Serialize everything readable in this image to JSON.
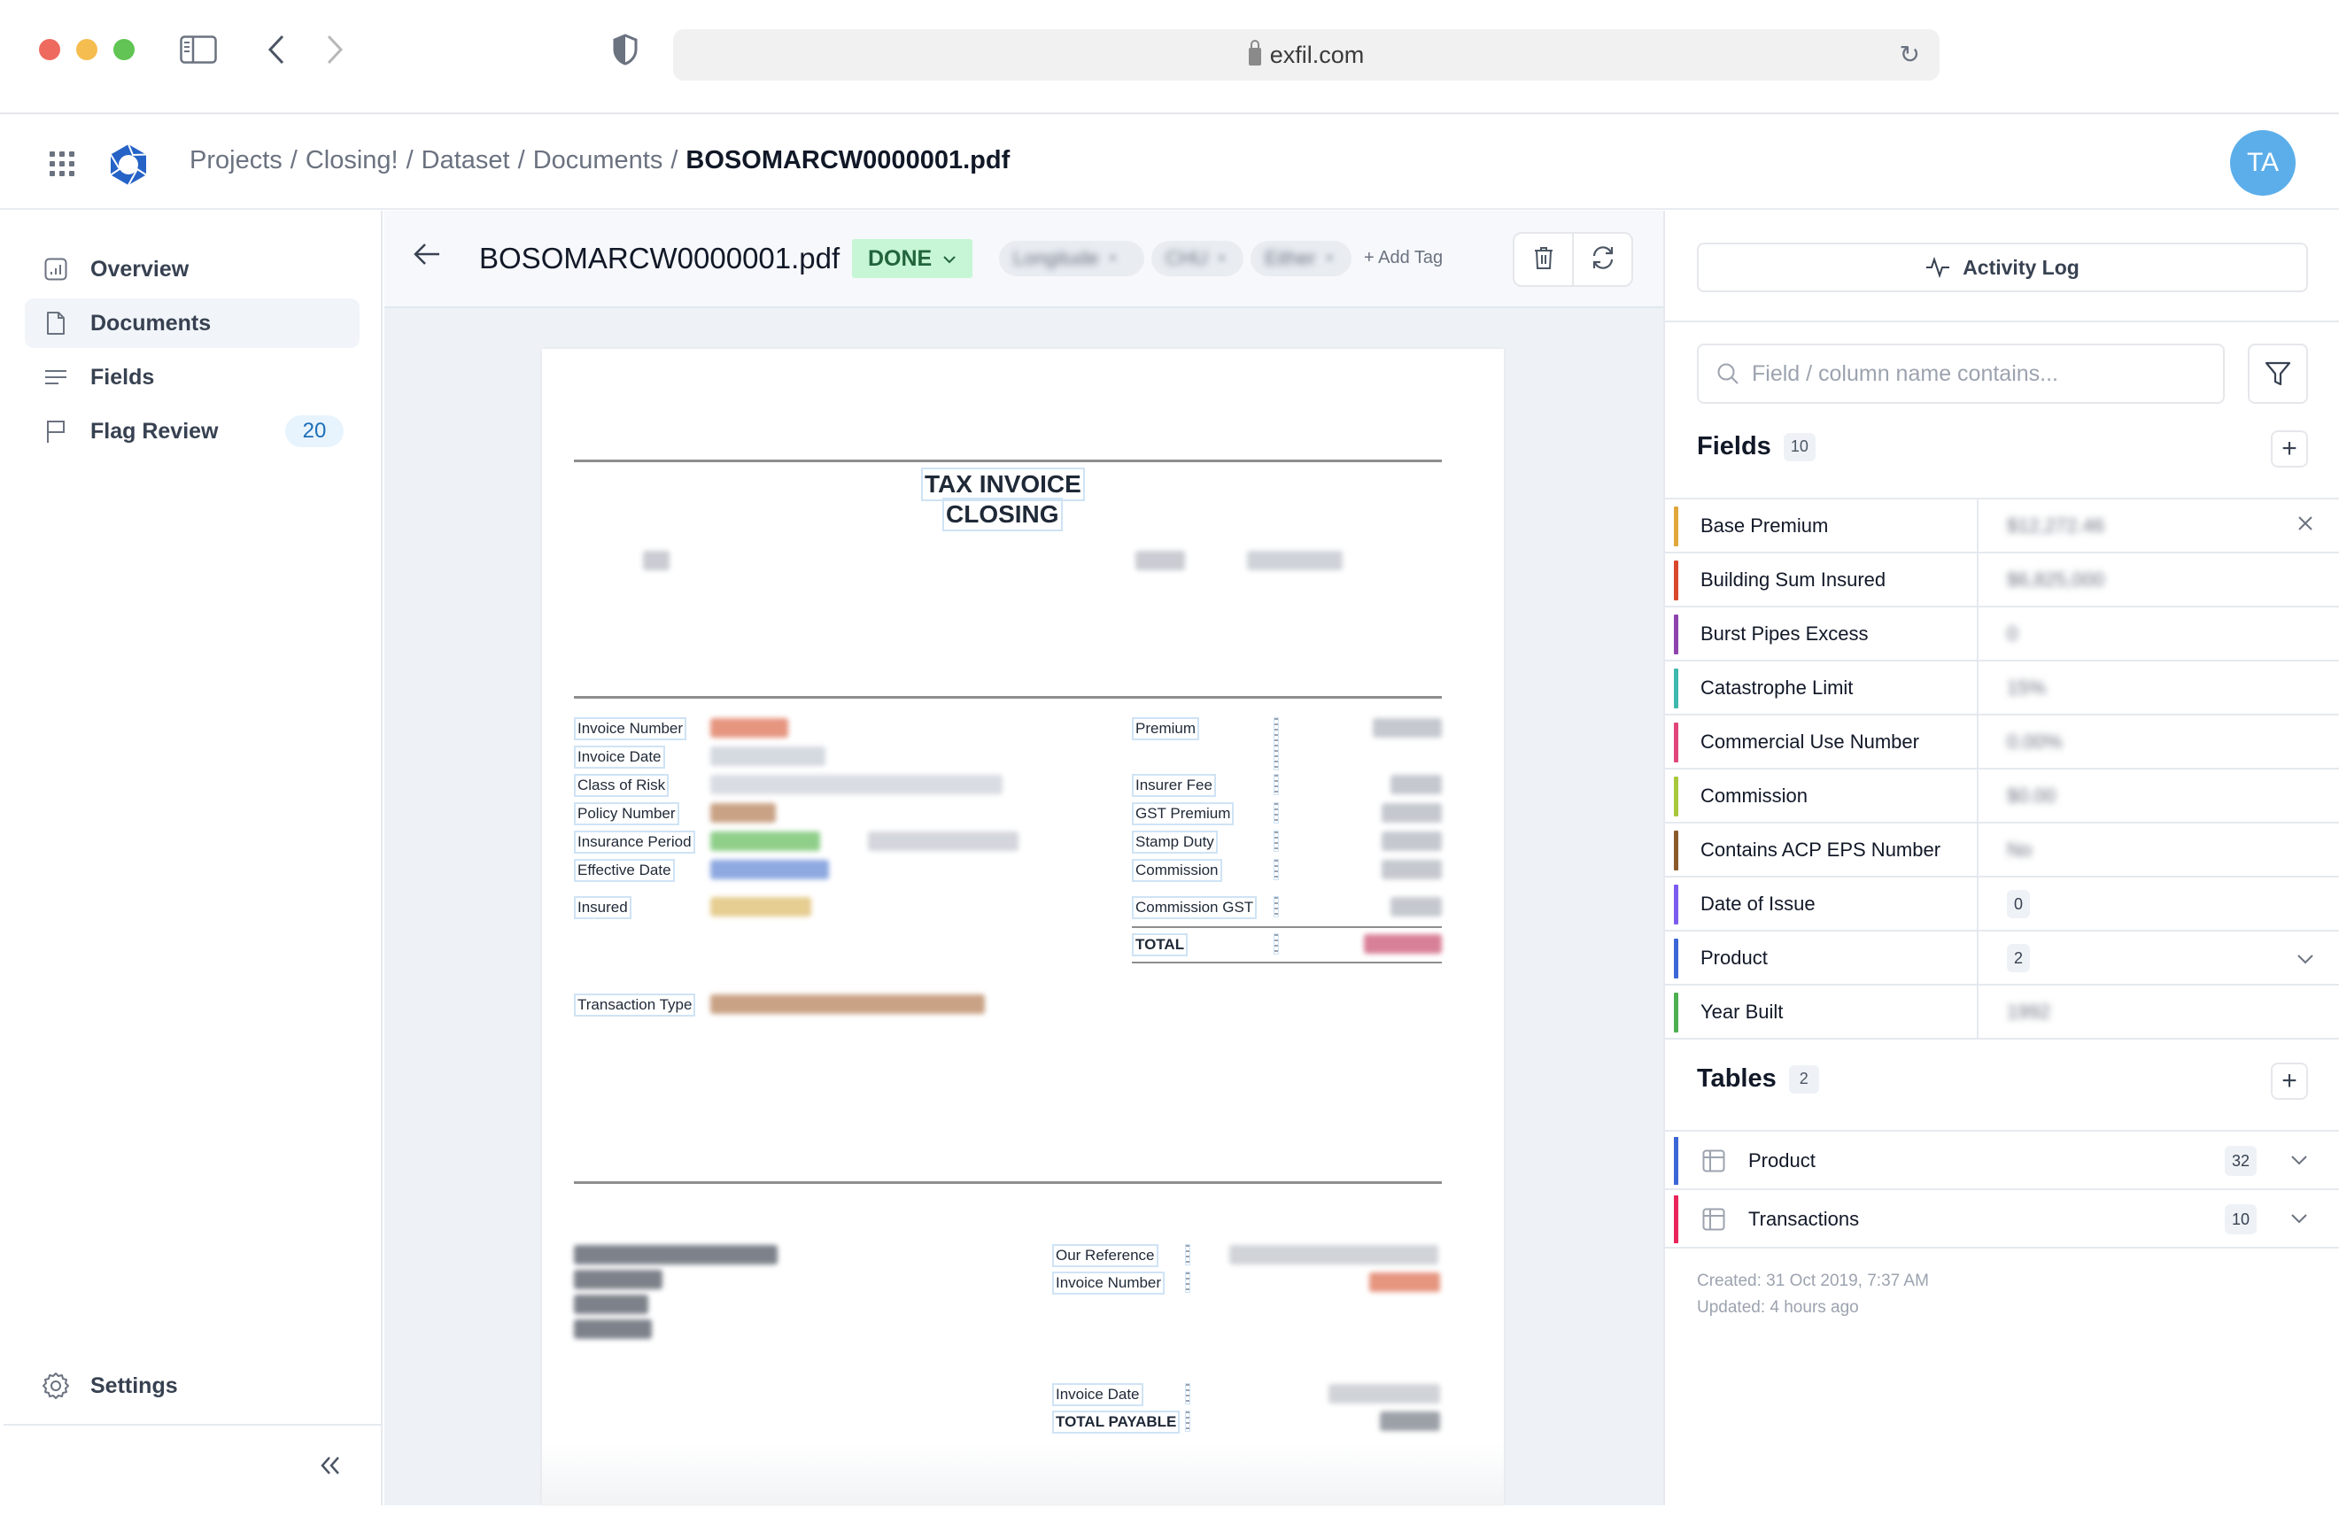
{
  "browser": {
    "url": "exfil.com",
    "icons": [
      "sidebar-toggle-icon",
      "back-icon",
      "forward-icon",
      "shield-icon",
      "lock-icon",
      "reload-icon"
    ]
  },
  "header": {
    "breadcrumb": [
      "Projects",
      "Closing!",
      "Dataset",
      "Documents"
    ],
    "current": "BOSOMARCW0000001.pdf",
    "avatar_initials": "TA",
    "avatar_color": "#5baeea"
  },
  "sidebar": {
    "items": [
      {
        "label": "Overview",
        "icon": "chart-icon"
      },
      {
        "label": "Documents",
        "icon": "document-icon",
        "active": true
      },
      {
        "label": "Fields",
        "icon": "fields-icon"
      },
      {
        "label": "Flag Review",
        "icon": "flag-icon",
        "count": "20"
      }
    ],
    "settings_label": "Settings",
    "collapse_label": "«"
  },
  "toolbar": {
    "title": "BOSOMARCW0000001.pdf",
    "status": "DONE",
    "status_color": "#c6f6d5",
    "tags": [
      "Longitude",
      "CHU",
      "Either"
    ],
    "add_tag_label": "+ Add Tag"
  },
  "document": {
    "title_line1": "TAX INVOICE",
    "title_line2": "CLOSING",
    "left_labels": [
      "Invoice Number",
      "Invoice Date",
      "Class of Risk",
      "Policy Number",
      "Insurance Period",
      "Effective Date",
      "Insured",
      "Transaction Type"
    ],
    "right_labels": [
      "Premium",
      "Insurer Fee",
      "GST Premium",
      "Stamp Duty",
      "Commission",
      "Commission GST",
      "TOTAL"
    ],
    "footer_labels": [
      "Our Reference",
      "Invoice Number",
      "Invoice Date",
      "TOTAL PAYABLE"
    ]
  },
  "right_panel": {
    "activity_log_label": "Activity Log",
    "search_placeholder": "Field / column name contains...",
    "fields_title": "Fields",
    "fields_count": "10",
    "fields": [
      {
        "name": "Base Premium",
        "value": "$12,272.46",
        "color": "#e0a83a",
        "action": "close"
      },
      {
        "name": "Building Sum Insured",
        "value": "$6,825,000",
        "color": "#d9482b"
      },
      {
        "name": "Burst Pipes Excess",
        "value": "0",
        "color": "#8e44ad"
      },
      {
        "name": "Catastrophe Limit",
        "value": "15%",
        "color": "#3fb8ae"
      },
      {
        "name": "Commercial Use Number",
        "value": "0.00%",
        "color": "#e0457b"
      },
      {
        "name": "Commission",
        "value": "$0.00",
        "color": "#a8c83c"
      },
      {
        "name": "Contains ACP EPS Number",
        "value": "No",
        "color": "#8b5a2b"
      },
      {
        "name": "Date of Issue",
        "badge": "0",
        "color": "#7b5cf0"
      },
      {
        "name": "Product",
        "badge": "2",
        "color": "#3b66d6",
        "action": "expand"
      },
      {
        "name": "Year Built",
        "value": "1992",
        "color": "#4caf50"
      }
    ],
    "tables_title": "Tables",
    "tables_count": "2",
    "tables": [
      {
        "name": "Product",
        "count": "32",
        "color": "#3b66d6"
      },
      {
        "name": "Transactions",
        "count": "10",
        "color": "#e8245a"
      }
    ],
    "created": "Created: 31 Oct 2019, 7:37 AM",
    "updated": "Updated: 4 hours ago"
  }
}
